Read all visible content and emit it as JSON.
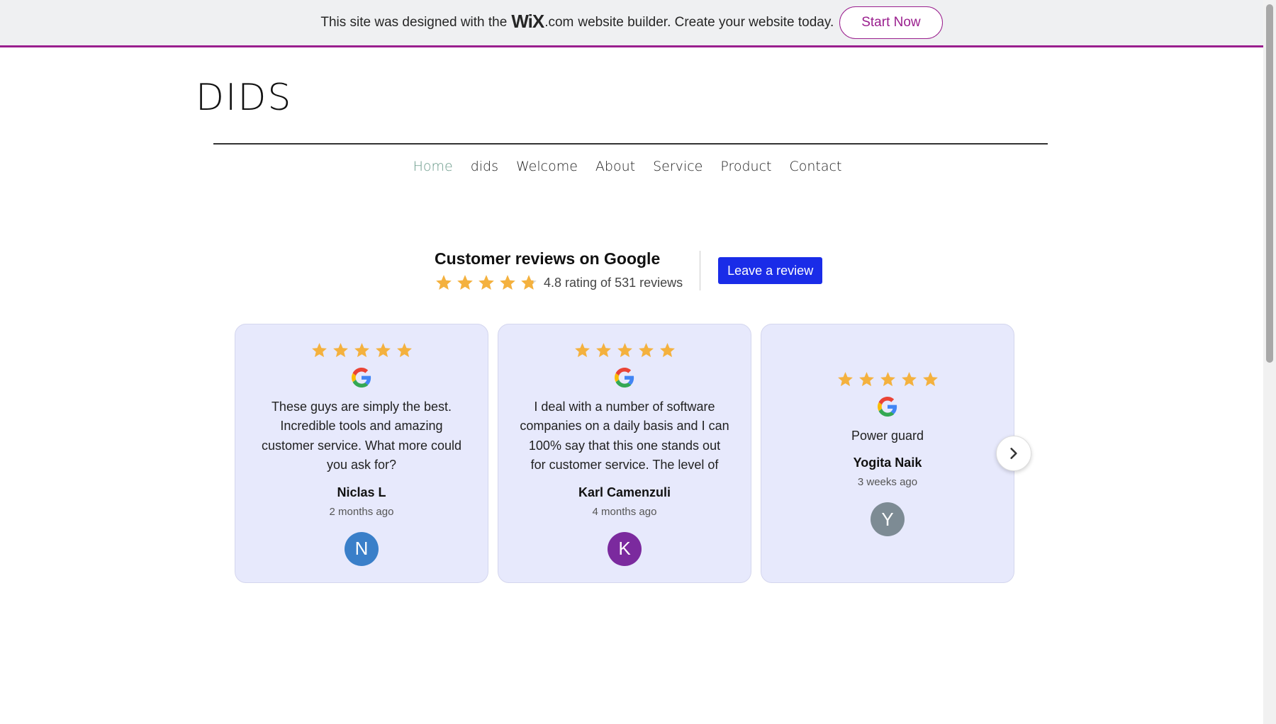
{
  "banner": {
    "text_before": "This site was designed with the",
    "wix_logo": "WiX",
    "dotcom": ".com",
    "text_after": "website builder. Create your website today.",
    "cta_label": "Start Now"
  },
  "site": {
    "logo": "DIDS"
  },
  "nav": {
    "items": [
      {
        "label": "Home"
      },
      {
        "label": "dids"
      },
      {
        "label": "Welcome"
      },
      {
        "label": "About"
      },
      {
        "label": "Service"
      },
      {
        "label": "Product"
      },
      {
        "label": "Contact"
      }
    ]
  },
  "reviews": {
    "title": "Customer reviews on Google",
    "rating_text": "4.8 rating of 531 reviews",
    "rating_value": 4.8,
    "leave_review_label": "Leave a review",
    "cards": [
      {
        "text": "These guys are simply the best. Incredible tools and amazing customer service. What more could you ask for?",
        "name": "Niclas L",
        "time": "2 months ago",
        "initial": "N",
        "avatar_color": "#3a7fc9"
      },
      {
        "text": "I deal with a number of software companies on a daily basis and I can 100% say that this one stands out for customer service. The level of suppo…",
        "name": "Karl Camenzuli",
        "time": "4 months ago",
        "initial": "K",
        "avatar_color": "#7b2a9e"
      },
      {
        "text": "Power guard",
        "name": "Yogita Naik",
        "time": "3 weeks ago",
        "initial": "Y",
        "avatar_color": "#7d8b94"
      }
    ]
  },
  "colors": {
    "wix_accent": "#9a1f8e",
    "star": "#f4b13e",
    "button_blue": "#1a2ce8",
    "card_bg": "#e7e9fc",
    "nav_active": "#6a9a8a"
  }
}
